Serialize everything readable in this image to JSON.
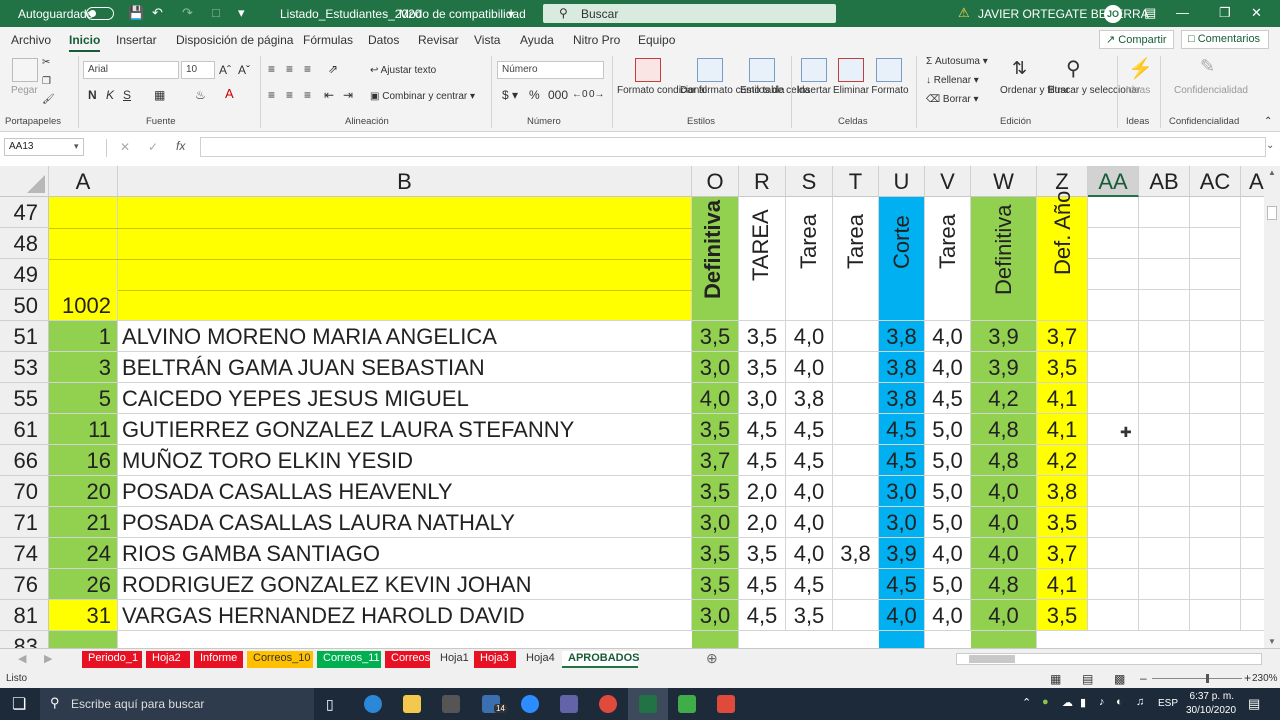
{
  "titlebar": {
    "autosave_label": "Autoguardado",
    "filename": "Listado_Estudiantes_2020",
    "mode": "Modo de compatibilidad",
    "search_placeholder": "Buscar",
    "user": "JAVIER  ORTEGATE BECERRA",
    "user_initials": "JO"
  },
  "ribbon_tabs": [
    "Archivo",
    "Inicio",
    "Insertar",
    "Disposición de página",
    "Fórmulas",
    "Datos",
    "Revisar",
    "Vista",
    "Ayuda",
    "Nitro Pro",
    "Equipo"
  ],
  "ribbon_actions": {
    "share": "Compartir",
    "comments": "Comentarios"
  },
  "ribbon": {
    "paste": "Pegar",
    "font_name": "Arial",
    "font_size": "10",
    "wrap_text": "Ajustar texto",
    "merge_center": "Combinar y centrar",
    "number_format": "Número",
    "cond_format": "Formato condicional",
    "table_format": "Dar formato como tabla",
    "cell_styles": "Estilos de celda",
    "insert": "Insertar",
    "delete": "Eliminar",
    "format": "Formato",
    "autosum": "Autosuma",
    "fill": "Rellenar",
    "clear": "Borrar",
    "sort_filter": "Ordenar y filtrar",
    "find_select": "Buscar y seleccionar",
    "ideas": "Ideas",
    "confidentiality": "Confidencialidad",
    "groups": [
      "Portapapeles",
      "Fuente",
      "Alineación",
      "Número",
      "Estilos",
      "Celdas",
      "Edición",
      "Ideas",
      "Confidencialidad"
    ]
  },
  "formula_bar": {
    "name_box": "AA13",
    "fx": "fx",
    "content": ""
  },
  "columns": [
    "A",
    "B",
    "O",
    "R",
    "S",
    "T",
    "U",
    "V",
    "W",
    "Z",
    "AA",
    "AB",
    "AC",
    "A"
  ],
  "header_rows": [
    "47",
    "48",
    "49",
    "50"
  ],
  "header_cell_a50": "1002",
  "vertical_headers": [
    "Definitiva",
    "TAREA",
    "Tarea",
    "Tarea",
    "Corte",
    "Tarea",
    "Definitiva",
    "Def. Año"
  ],
  "rows": [
    {
      "row": "51",
      "a": "1",
      "name": "ALVINO MORENO MARIA ANGELICA",
      "o": "3,5",
      "r": "3,5",
      "s": "4,0",
      "t": "",
      "u": "3,8",
      "v": "4,0",
      "w": "3,9",
      "z": "3,7"
    },
    {
      "row": "53",
      "a": "3",
      "name": "BELTRÁN GAMA JUAN SEBASTIAN",
      "o": "3,0",
      "r": "3,5",
      "s": "4,0",
      "t": "",
      "u": "3,8",
      "v": "4,0",
      "w": "3,9",
      "z": "3,5"
    },
    {
      "row": "55",
      "a": "5",
      "name": "CAICEDO YEPES JESUS MIGUEL",
      "o": "4,0",
      "r": "3,0",
      "s": "3,8",
      "t": "",
      "u": "3,8",
      "v": "4,5",
      "w": "4,2",
      "z": "4,1"
    },
    {
      "row": "61",
      "a": "11",
      "name": "GUTIERREZ GONZALEZ LAURA STEFANNY",
      "o": "3,5",
      "r": "4,5",
      "s": "4,5",
      "t": "",
      "u": "4,5",
      "v": "5,0",
      "w": "4,8",
      "z": "4,1"
    },
    {
      "row": "66",
      "a": "16",
      "name": "MUÑOZ TORO ELKIN YESID",
      "o": "3,7",
      "r": "4,5",
      "s": "4,5",
      "t": "",
      "u": "4,5",
      "v": "5,0",
      "w": "4,8",
      "z": "4,2"
    },
    {
      "row": "70",
      "a": "20",
      "name": "POSADA CASALLAS HEAVENLY",
      "o": "3,5",
      "r": "2,0",
      "s": "4,0",
      "t": "",
      "u": "3,0",
      "v": "5,0",
      "w": "4,0",
      "z": "3,8"
    },
    {
      "row": "71",
      "a": "21",
      "name": "POSADA CASALLAS LAURA NATHALY",
      "o": "3,0",
      "r": "2,0",
      "s": "4,0",
      "t": "",
      "u": "3,0",
      "v": "5,0",
      "w": "4,0",
      "z": "3,5"
    },
    {
      "row": "74",
      "a": "24",
      "name": "RIOS GAMBA SANTIAGO",
      "o": "3,5",
      "r": "3,5",
      "s": "4,0",
      "t": "3,8",
      "u": "3,9",
      "v": "4,0",
      "w": "4,0",
      "z": "3,7"
    },
    {
      "row": "76",
      "a": "26",
      "name": "RODRIGUEZ GONZALEZ KEVIN JOHAN",
      "o": "3,5",
      "r": "4,5",
      "s": "4,5",
      "t": "",
      "u": "4,5",
      "v": "5,0",
      "w": "4,8",
      "z": "4,1"
    },
    {
      "row": "81",
      "a": "31",
      "name": "VARGAS HERNANDEZ HAROLD DAVID",
      "o": "3,0",
      "r": "4,5",
      "s": "3,5",
      "t": "",
      "u": "4,0",
      "v": "4,0",
      "w": "4,0",
      "z": "3,5"
    }
  ],
  "partial_row": "83",
  "sheet_tabs": [
    {
      "name": "Periodo_1",
      "color": "#e81123"
    },
    {
      "name": "Hoja2",
      "color": "#e81123"
    },
    {
      "name": "Informe",
      "color": "#e81123"
    },
    {
      "name": "Correos_10",
      "color": "#ffc000"
    },
    {
      "name": "Correos_11",
      "color": "#00b050"
    },
    {
      "name": "Correos",
      "color": "#e81123"
    },
    {
      "name": "Hoja1",
      "color": ""
    },
    {
      "name": "Hoja3",
      "color": "#e81123"
    },
    {
      "name": "Hoja4",
      "color": ""
    },
    {
      "name": "APROBADOS",
      "color": ""
    }
  ],
  "status": {
    "mode": "Listo",
    "zoom": "230%"
  },
  "taskbar": {
    "search_placeholder": "Escribe aquí para buscar",
    "language": "ESP",
    "time": "6:37 p. m.",
    "date": "30/10/2020",
    "badge": "14"
  },
  "colors": {
    "excel_green": "#217346",
    "green_fill": "#92d050",
    "yellow_fill": "#ffff00",
    "blue_fill": "#00b0f0",
    "comment_marker": "#e02020"
  }
}
